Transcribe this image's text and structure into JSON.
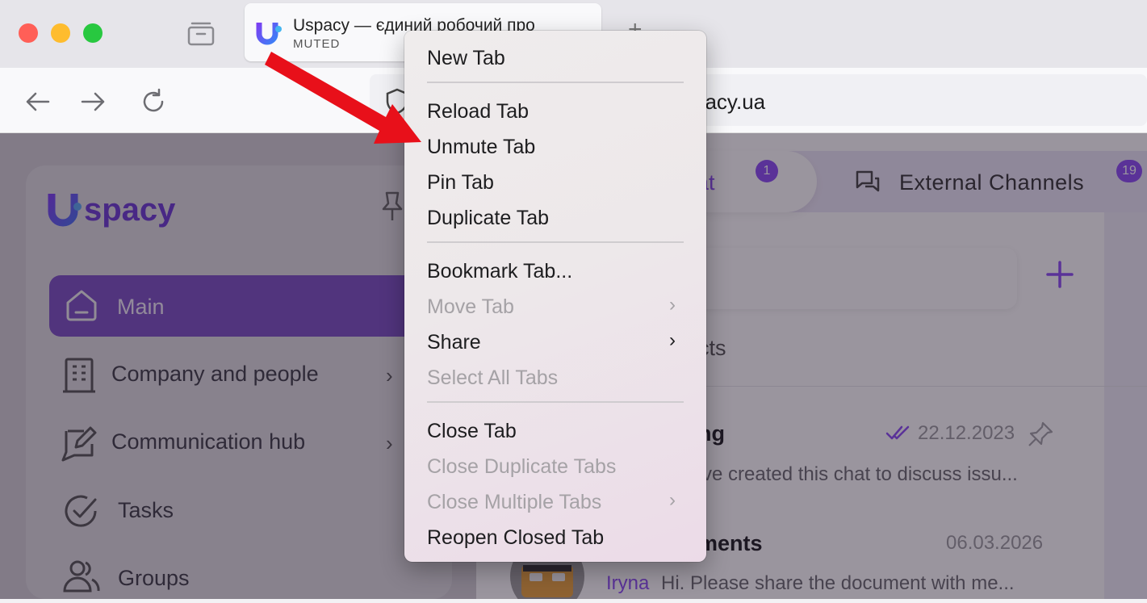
{
  "browser": {
    "tab": {
      "title": "Uspacy — єдиний робочий про",
      "status": "MUTED"
    },
    "url": "spacy.ua"
  },
  "app": {
    "logo_text": "spacy",
    "sidebar": {
      "items": [
        {
          "label": "Main"
        },
        {
          "label": "Company and people"
        },
        {
          "label": "Communication hub"
        },
        {
          "label": "Tasks"
        },
        {
          "label": "Groups"
        }
      ]
    },
    "tabs": [
      {
        "label": "hat",
        "badge": "1"
      },
      {
        "label": "External Channels",
        "badge": "19"
      }
    ],
    "partial_text": "cts",
    "chats": [
      {
        "title": "ng",
        "date": "22.12.2023",
        "preview": "ve created this chat to discuss issu..."
      },
      {
        "title": "ments",
        "date": "06.03.2026",
        "sender": "Iryna",
        "preview": "Hi. Please share the document with me..."
      }
    ]
  },
  "context_menu": {
    "items": [
      {
        "label": "New Tab"
      },
      {
        "label": "Reload Tab"
      },
      {
        "label": "Unmute Tab"
      },
      {
        "label": "Pin Tab"
      },
      {
        "label": "Duplicate Tab"
      },
      {
        "label": "Bookmark Tab..."
      },
      {
        "label": "Move Tab"
      },
      {
        "label": "Share"
      },
      {
        "label": "Select All Tabs"
      },
      {
        "label": "Close Tab"
      },
      {
        "label": "Close Duplicate Tabs"
      },
      {
        "label": "Close Multiple Tabs"
      },
      {
        "label": "Reopen Closed Tab"
      }
    ]
  },
  "colors": {
    "accent": "#8a4cf5",
    "arrow": "#e8101a",
    "close_light": "#ff5f57",
    "minimize_light": "#febc2e",
    "zoom_light": "#28c840"
  }
}
